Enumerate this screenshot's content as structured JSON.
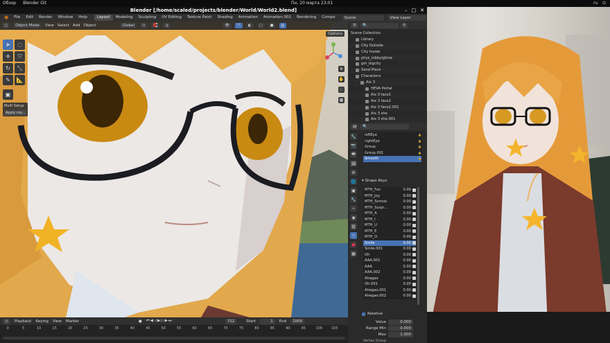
{
  "system": {
    "left_items": [
      "Обзор",
      "Blender Git"
    ],
    "clock": "Пн, 20 марта  23:01",
    "tray": [
      "ru",
      "⏻"
    ]
  },
  "window": {
    "title": "Blender [/home/scaled/projects/blender/World/World2.blend]",
    "controls": [
      "–",
      "□",
      "✕"
    ]
  },
  "menubar": {
    "menus": [
      "File",
      "Edit",
      "Render",
      "Window",
      "Help"
    ],
    "workspaces": [
      "Layout",
      "Modeling",
      "Sculpting",
      "UV Editing",
      "Texture Paint",
      "Shading",
      "Animation",
      "Animation.001",
      "Rendering",
      "Compo"
    ],
    "active_workspace": "Layout",
    "scene": "Scene",
    "view_layer": "View Layer"
  },
  "viewport": {
    "mode": "Object Mode",
    "menus": [
      "View",
      "Select",
      "Add",
      "Object"
    ],
    "orientation": "Global",
    "options_label": "Options",
    "operator_panel": {
      "title": "Multi Setup",
      "button": "Apply mo..."
    }
  },
  "outliner": {
    "title": "Scene Collection",
    "rows": [
      {
        "label": "Library",
        "indent": 1
      },
      {
        "label": "City Outside",
        "indent": 1
      },
      {
        "label": "City Inside",
        "indent": 1
      },
      {
        "label": "phys_lobbylgtlow",
        "indent": 1
      },
      {
        "label": "gm_bigcity",
        "indent": 1
      },
      {
        "label": "Sand Place",
        "indent": 1
      },
      {
        "label": "Characters",
        "indent": 1
      },
      {
        "label": "Aix 3",
        "indent": 2
      },
      {
        "label": "HEVA Portal",
        "indent": 3
      },
      {
        "label": "Aix 3 face1",
        "indent": 3
      },
      {
        "label": "Aix 3 face2",
        "indent": 3
      },
      {
        "label": "Aix 3 face2.001",
        "indent": 3
      },
      {
        "label": "Aix 3 she",
        "indent": 3
      },
      {
        "label": "Aix 3 she.001",
        "indent": 3
      }
    ]
  },
  "properties": {
    "vertex_groups": [
      "leftEye",
      "rightEye",
      "Group",
      "Group.001",
      "Smooth"
    ],
    "selected_vertex_group": "Smooth",
    "shape_keys_title": "Shape Keys",
    "shape_keys": [
      {
        "name": "MTH_Fun",
        "value": "0.00"
      },
      {
        "name": "MTH_Joy",
        "value": "0.00"
      },
      {
        "name": "MTH_Sorrow",
        "value": "0.00"
      },
      {
        "name": "MTH_Surpr...",
        "value": "0.00"
      },
      {
        "name": "MTH_A",
        "value": "0.00"
      },
      {
        "name": "MTH_I",
        "value": "0.00"
      },
      {
        "name": "MTH_U",
        "value": "0.00"
      },
      {
        "name": "MTH_E",
        "value": "0.00"
      },
      {
        "name": "MTH_O",
        "value": "0.00"
      },
      {
        "name": "Smile",
        "value": "0.00"
      },
      {
        "name": "Smile.001",
        "value": "0.00"
      },
      {
        "name": "Oh",
        "value": "0.00"
      },
      {
        "name": "AAA.001",
        "value": "0.00"
      },
      {
        "name": "AAA",
        "value": "0.00"
      },
      {
        "name": "AAA.002",
        "value": "0.00"
      },
      {
        "name": "Ahegao",
        "value": "0.00"
      },
      {
        "name": "Oh.001",
        "value": "0.00"
      },
      {
        "name": "Ahegao.001",
        "value": "0.00"
      },
      {
        "name": "Ahegao.002",
        "value": "0.00"
      }
    ],
    "selected_shape_key": "Smile",
    "relative_label": "Relative",
    "value_label": "Value",
    "value": "0.000",
    "range_min_label": "Range Min",
    "range_min": "0.000",
    "max_label": "Max",
    "max": "1.000",
    "footer": "Vertex Group"
  },
  "timeline": {
    "menus": [
      "Playback",
      "Keying",
      "View",
      "Marker"
    ],
    "current_frame": "722",
    "start_label": "Start",
    "start": "1",
    "end_label": "End",
    "end": "1000",
    "ticks": [
      "0",
      "5",
      "10",
      "15",
      "20",
      "25",
      "30",
      "35",
      "40",
      "45",
      "50",
      "55",
      "60",
      "65",
      "70",
      "75",
      "80",
      "85",
      "90",
      "95",
      "100",
      "105"
    ]
  },
  "colors": {
    "accent": "#4772b3",
    "header": "#303030",
    "panel": "#2a2a2a"
  }
}
